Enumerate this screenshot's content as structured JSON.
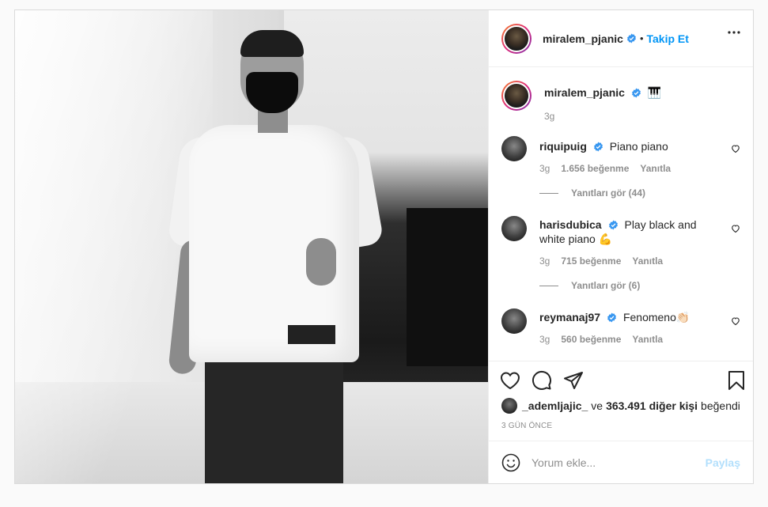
{
  "header": {
    "username": "miralem_pjanic",
    "separator": "•",
    "follow_label": "Takip Et"
  },
  "caption": {
    "username": "miralem_pjanic",
    "text": "🎹",
    "time": "3g"
  },
  "comments": [
    {
      "username": "riquipuig",
      "text": "Piano piano",
      "time": "3g",
      "likes": "1.656 beğenme",
      "reply_label": "Yanıtla",
      "view_replies": "Yanıtları gör (44)"
    },
    {
      "username": "harisdubica",
      "text": "Play black and white piano 💪",
      "time": "3g",
      "likes": "715 beğenme",
      "reply_label": "Yanıtla",
      "view_replies": "Yanıtları gör (6)"
    },
    {
      "username": "reymanaj97",
      "text": "Fenomeno👏🏻",
      "time": "3g",
      "likes": "560 beğenme",
      "reply_label": "Yanıtla"
    }
  ],
  "likes_summary": {
    "user": "_ademljajic_",
    "connector": "ve",
    "others": "363.491 diğer kişi",
    "suffix": "beğendi"
  },
  "timestamp": "3 gün önce",
  "comment_input": {
    "placeholder": "Yorum ekle...",
    "post_label": "Paylaş"
  },
  "icons": {
    "more": "more-options-icon",
    "like": "heart-icon",
    "comment": "comment-icon",
    "share": "share-icon",
    "save": "bookmark-icon",
    "emoji": "emoji-icon",
    "verified": "verified-badge-icon"
  },
  "colors": {
    "accent": "#0095f6",
    "verified": "#3897f0",
    "post_disabled": "#b2dffc",
    "muted": "#8e8e8e"
  }
}
